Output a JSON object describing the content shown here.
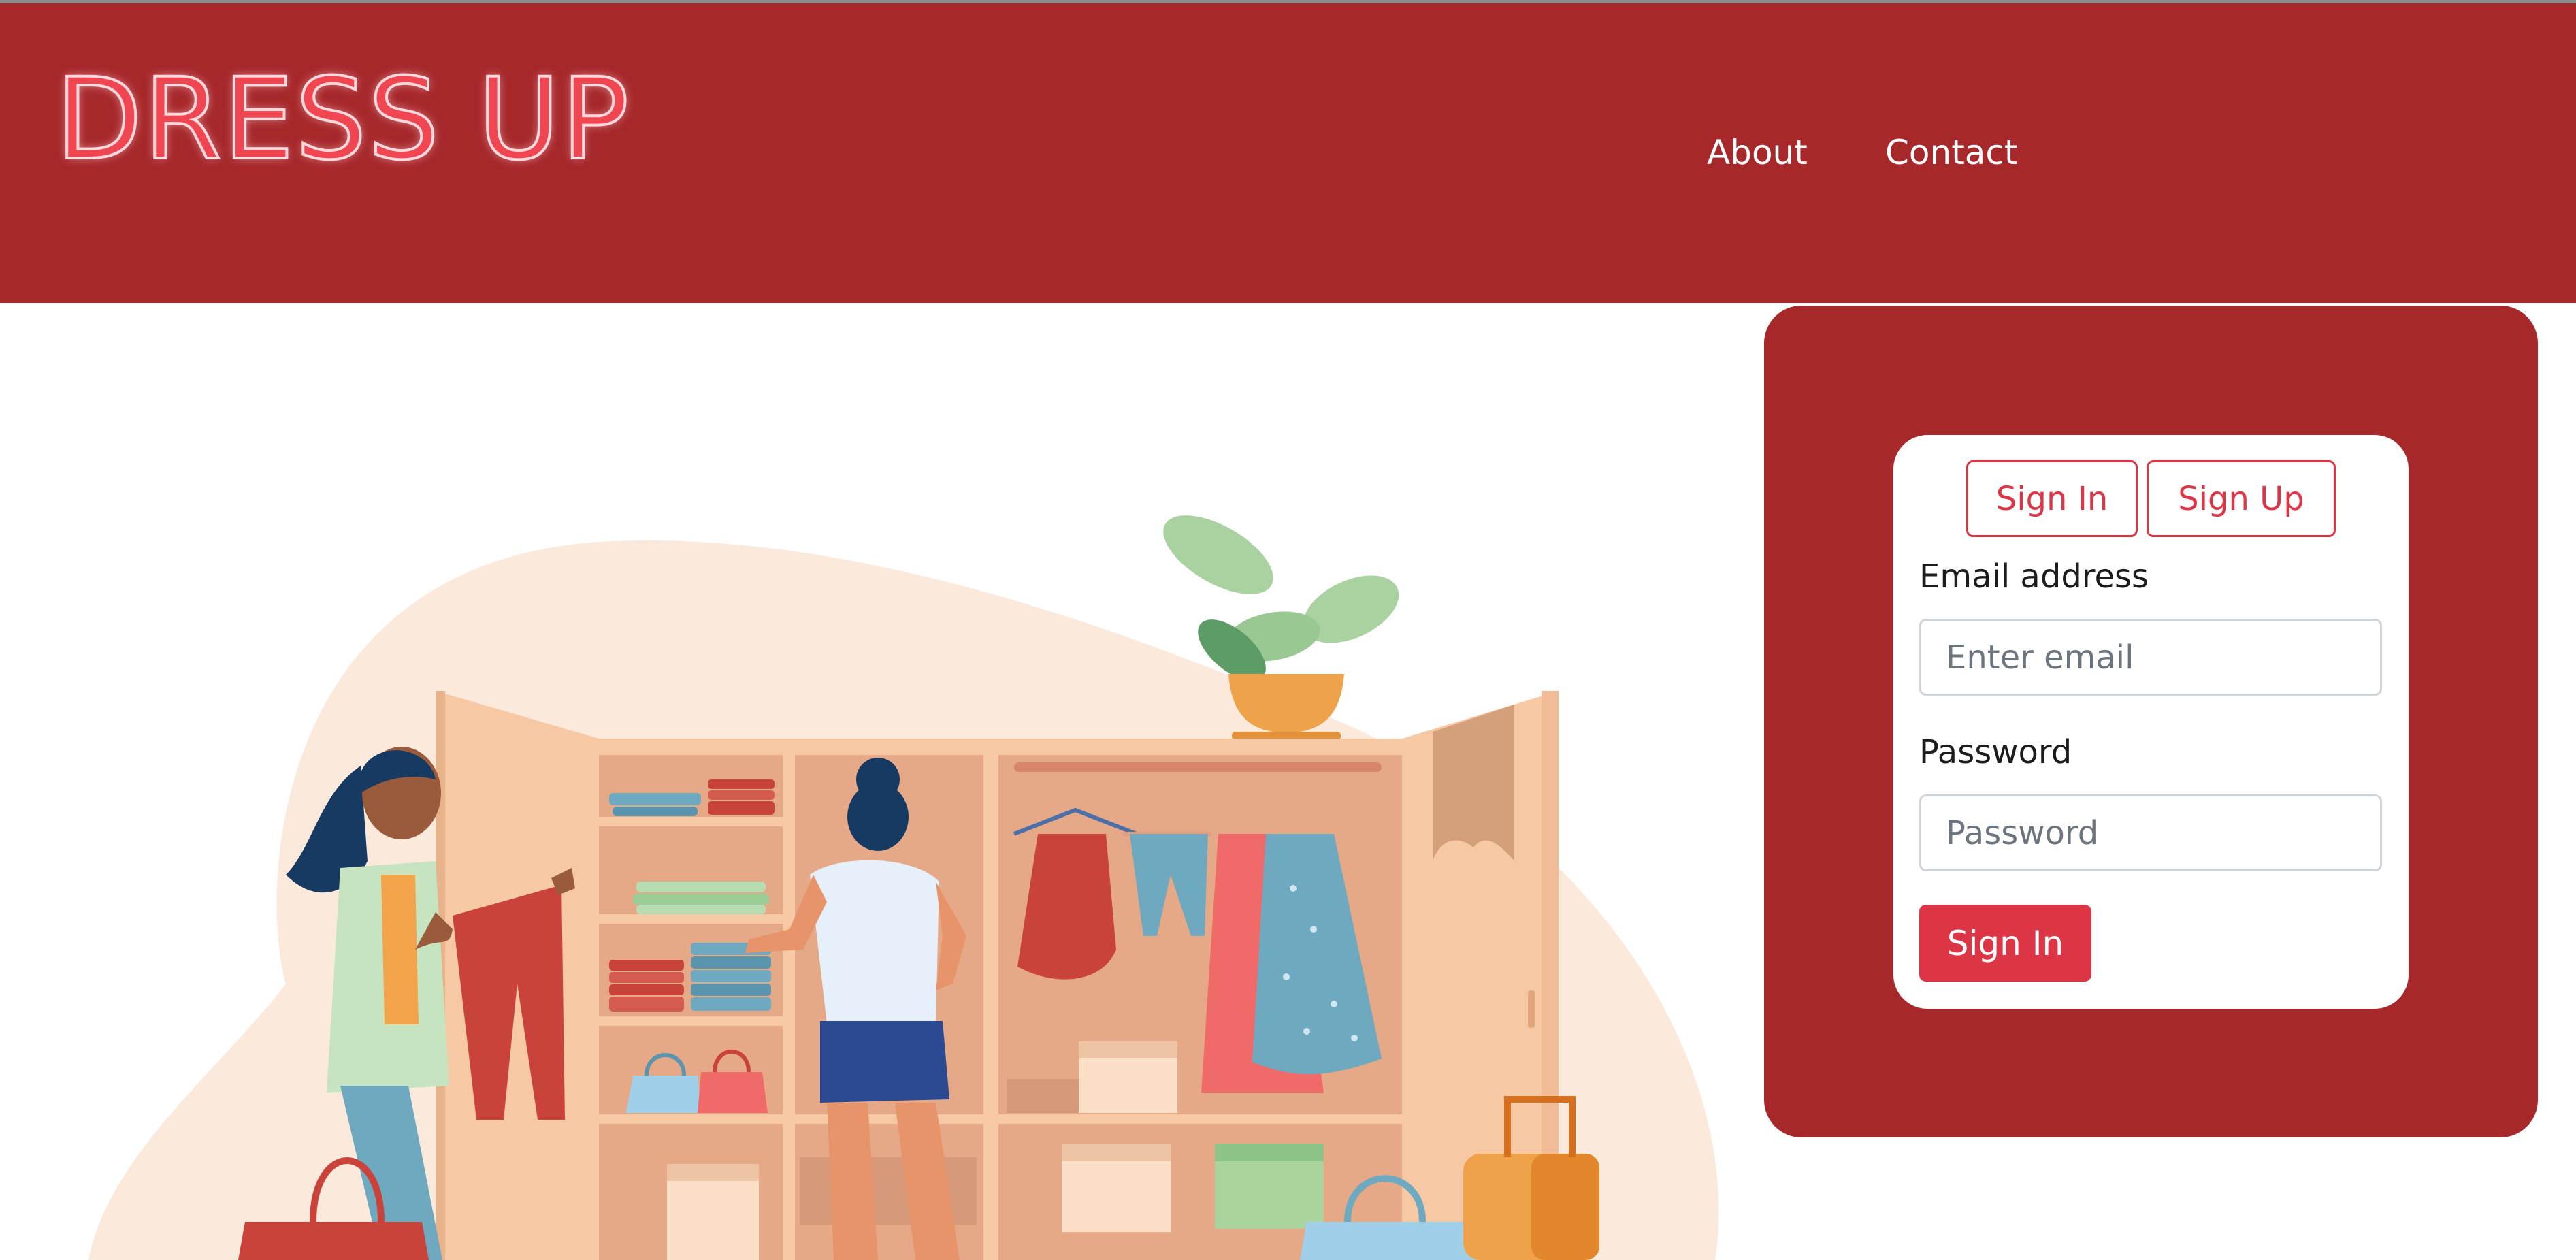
{
  "header": {
    "brand": "DRESS UP",
    "nav": [
      {
        "label": "About"
      },
      {
        "label": "Contact"
      }
    ]
  },
  "auth": {
    "tabs": {
      "sign_in": "Sign In",
      "sign_up": "Sign Up"
    },
    "email": {
      "label": "Email address",
      "placeholder": "Enter email",
      "value": ""
    },
    "password": {
      "label": "Password",
      "placeholder": "Password",
      "value": ""
    },
    "submit": "Sign In"
  },
  "colors": {
    "header_bg": "#a6282b",
    "accent": "#dc3545",
    "brand_text": "#ef4652"
  }
}
